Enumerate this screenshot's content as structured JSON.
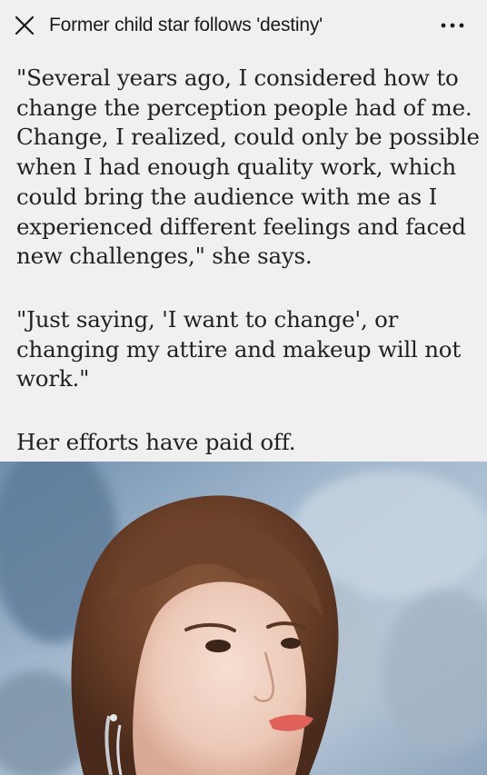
{
  "header": {
    "title": "Former child star follows 'destiny'",
    "close_icon": "close-icon",
    "more_icon": "more-horizontal-icon"
  },
  "article": {
    "paragraphs": [
      {
        "lines": [
          "\"Several years ago, I considered how to",
          "change the perception people had of me.",
          "Change, I realized, could only be possible",
          "when I had enough quality work, which",
          "could bring the audience with me as I",
          "experienced different feelings and faced",
          "new challenges,\" she says."
        ]
      },
      {
        "lines": [
          "\"Just saying, 'I want to change', or",
          "changing my attire and makeup will not",
          "work.\""
        ]
      },
      {
        "lines": [
          "Her efforts have paid off."
        ]
      }
    ]
  },
  "colors": {
    "background": "#f0f0f0",
    "text": "#222222",
    "title": "#1a1a1a"
  }
}
